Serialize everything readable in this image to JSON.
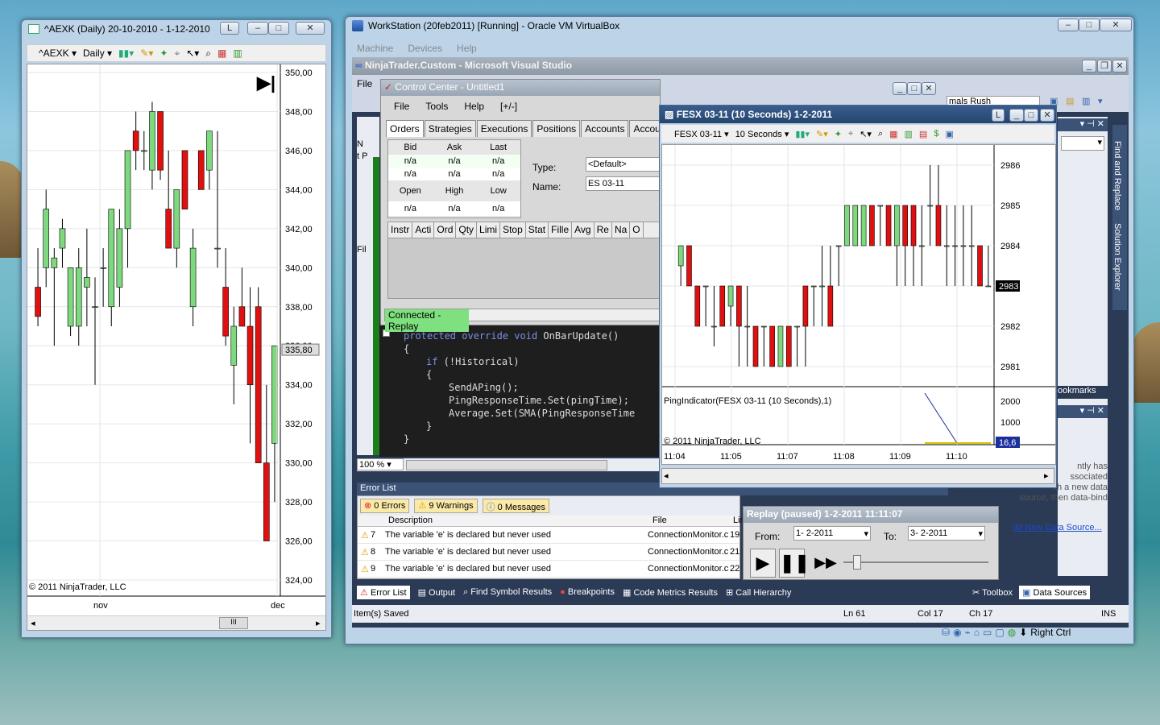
{
  "left_chart": {
    "title": "^AEXK (Daily)  20-10-2010 - 1-12-2010",
    "title_badge": "L",
    "instrument": "^AEXK",
    "period": "Daily",
    "price_label": "335,80",
    "copyright": "© 2011 NinjaTrader, LLC",
    "scroll_mark": "III",
    "y_ticks": [
      "350,00",
      "348,00",
      "346,00",
      "344,00",
      "342,00",
      "340,00",
      "338,00",
      "336,00",
      "334,00",
      "332,00",
      "330,00",
      "328,00",
      "326,00",
      "324,00"
    ],
    "x_ticks": [
      "nov",
      "dec"
    ]
  },
  "vbox": {
    "title": "WorkStation (20feb2011) [Running] - Oracle VM VirtualBox",
    "menu": [
      "Machine",
      "Devices",
      "Help"
    ],
    "status_right": "Right Ctrl"
  },
  "vs": {
    "title": "NinjaTrader.Custom - Microsoft Visual Studio",
    "file_menu": "File",
    "zoom": "100 %",
    "code_lines": [
      "protected override void OnBarUpdate()",
      "{",
      "if (!Historical)",
      "{",
      "SendAPing();",
      "PingResponseTime.Set(pingTime);",
      "Average.Set(SMA(PingResponseTime",
      "}",
      "}"
    ],
    "error_list": {
      "title": "Error List",
      "errors": "0 Errors",
      "warnings": "9 Warnings",
      "messages": "0 Messages",
      "col_description": "Description",
      "col_file": "File",
      "col_line": "Lin",
      "rows": [
        {
          "num": "7",
          "desc": "The variable 'e' is declared but never used",
          "file": "ConnectionMonitor.c",
          "line": "19"
        },
        {
          "num": "8",
          "desc": "The variable 'e' is declared but never used",
          "file": "ConnectionMonitor.c",
          "line": "21"
        },
        {
          "num": "9",
          "desc": "The variable 'e' is declared but never used",
          "file": "ConnectionMonitor.c",
          "line": "22"
        }
      ]
    },
    "bottom_tabs": [
      "Error List",
      "Output",
      "Find Symbol Results",
      "Breakpoints",
      "Code Metrics Results",
      "Call Hierarchy"
    ],
    "right_tabs": [
      "Toolbox",
      "Data Sources"
    ],
    "status": {
      "saved": "Item(s) Saved",
      "ln": "Ln 61",
      "col": "Col 17",
      "ch": "Ch 17",
      "ins": "INS"
    },
    "side_labels": [
      "Find and Replace",
      "Solution Explorer"
    ],
    "bookmarks": "ookmarks",
    "ds_text": [
      "ntly has",
      "ssociated",
      "ith a new data",
      "source, then data-bind"
    ],
    "ds_link": "dd New Data Source...",
    "partial_text": "mals Rush",
    "left_partials": [
      "N",
      "t P",
      "Fil"
    ]
  },
  "control_center": {
    "title": "Control Center - Untitled1",
    "menu": [
      "File",
      "Tools",
      "Help",
      "[+/-]"
    ],
    "tabs": [
      "Orders",
      "Strategies",
      "Executions",
      "Positions",
      "Accounts",
      "Account Pe"
    ],
    "quote_headers": [
      "Bid",
      "Ask",
      "Last"
    ],
    "quote_rows": [
      [
        "n/a",
        "n/a",
        "n/a"
      ],
      [
        "n/a",
        "n/a",
        "n/a"
      ]
    ],
    "ohl_headers": [
      "Open",
      "High",
      "Low"
    ],
    "ohl_values": [
      "n/a",
      "n/a",
      "n/a"
    ],
    "type_label": "Type:",
    "type_value": "<Default>",
    "name_label": "Name:",
    "name_value": "ES 03-11",
    "order_cols": [
      "Instr",
      "Acti",
      "Ord",
      "Qty",
      "Limi",
      "Stop",
      "Stat",
      "Fille",
      "Avg",
      "Re",
      "Na",
      "O"
    ],
    "status": "Connected - Replay"
  },
  "fesx": {
    "title": "FESX 03-11 (10 Seconds)  1-2-2011",
    "title_badge": "L",
    "instrument": "FESX 03-11",
    "period": "10 Seconds",
    "price_label": "2983",
    "indicator_label": "PingIndicator(FESX 03-11 (10 Seconds),1)",
    "indicator_value": "16,6",
    "copyright": "© 2011 NinjaTrader, LLC",
    "y_ticks": [
      "2986",
      "2985",
      "2984",
      "2983",
      "2982",
      "2981"
    ],
    "ind_ticks": [
      "2000",
      "1000"
    ],
    "x_ticks": [
      "11:04",
      "11:05",
      "11:07",
      "11:08",
      "11:09",
      "11:10"
    ]
  },
  "replay": {
    "title": "Replay (paused) 1-2-2011 11:11:07",
    "from_label": "From:",
    "from_value": "1- 2-2011",
    "to_label": "To:",
    "to_value": "3- 2-2011"
  },
  "chart_data": [
    {
      "type": "candlestick",
      "title": "^AEXK (Daily)",
      "ylim": [
        324,
        350
      ],
      "x_ticks": [
        "nov",
        "dec"
      ],
      "last": 335.8,
      "candles": [
        [
          339,
          341,
          337,
          337.5
        ],
        [
          340,
          344,
          339,
          343
        ],
        [
          340,
          341,
          336,
          340.5
        ],
        [
          341,
          342.5,
          340,
          342
        ],
        [
          337,
          340,
          336.5,
          340
        ],
        [
          337,
          341,
          336,
          340
        ],
        [
          339,
          342,
          337,
          339.5
        ],
        [
          338,
          339.5,
          334,
          338
        ],
        [
          340,
          341,
          338,
          340
        ],
        [
          338,
          343,
          337,
          343
        ],
        [
          339,
          343,
          338,
          342
        ],
        [
          342,
          346,
          340,
          346
        ],
        [
          347,
          348,
          345,
          346
        ],
        [
          346,
          347,
          345,
          346
        ],
        [
          345,
          348.5,
          344,
          348
        ],
        [
          348,
          348,
          344.5,
          345
        ],
        [
          343,
          346,
          341,
          341
        ],
        [
          341,
          344,
          340,
          344
        ],
        [
          346,
          346,
          343,
          343
        ],
        [
          338,
          342,
          337,
          341
        ],
        [
          346,
          346,
          344,
          344
        ],
        [
          345,
          347,
          344,
          347
        ],
        [
          341,
          347,
          340,
          341
        ],
        [
          339,
          341,
          336,
          336.5
        ],
        [
          335,
          338,
          333,
          337
        ],
        [
          338,
          340,
          337,
          337
        ],
        [
          337,
          339,
          331,
          334
        ],
        [
          338,
          339,
          332,
          330
        ],
        [
          330,
          334,
          326,
          326
        ],
        [
          331,
          336,
          328,
          336
        ]
      ]
    },
    {
      "type": "candlestick",
      "title": "FESX 03-11 (10 Seconds)",
      "ylim": [
        2980.5,
        2986.3
      ],
      "x_ticks": [
        "11:04",
        "11:05",
        "11:07",
        "11:08",
        "11:09",
        "11:10"
      ],
      "last": 2983,
      "candles": [
        [
          2983.5,
          2984,
          2983,
          2984
        ],
        [
          2984,
          2984,
          2983,
          2983
        ],
        [
          2983,
          2983,
          2982,
          2982
        ],
        [
          2983,
          2983,
          2982,
          2983
        ],
        [
          2982,
          2983,
          2981.5,
          2982
        ],
        [
          2983,
          2983,
          2982,
          2982
        ],
        [
          2982.5,
          2983,
          2982,
          2983
        ],
        [
          2983,
          2983,
          2981,
          2982
        ],
        [
          2982,
          2983,
          2981,
          2982
        ],
        [
          2982,
          2982,
          2981,
          2981
        ],
        [
          2982,
          2982,
          2981,
          2982
        ],
        [
          2982,
          2982,
          2981,
          2981
        ],
        [
          2981,
          2982,
          2981,
          2982
        ],
        [
          2982,
          2982,
          2981,
          2981
        ],
        [
          2982,
          2982,
          2981,
          2982
        ],
        [
          2983,
          2983,
          2981,
          2982
        ],
        [
          2983,
          2983,
          2982,
          2983
        ],
        [
          2983,
          2984,
          2982,
          2983
        ],
        [
          2983,
          2984,
          2982,
          2982
        ],
        [
          2984,
          2984,
          2983,
          2984
        ],
        [
          2984,
          2985,
          2984,
          2985
        ],
        [
          2984,
          2985,
          2984,
          2985
        ],
        [
          2984,
          2985,
          2984,
          2985
        ],
        [
          2985,
          2985,
          2984,
          2984
        ],
        [
          2985,
          2985,
          2984,
          2985
        ],
        [
          2985,
          2985,
          2984,
          2984
        ],
        [
          2984,
          2985,
          2983,
          2985
        ],
        [
          2985,
          2985,
          2983,
          2984
        ],
        [
          2985,
          2985,
          2983,
          2984
        ],
        [
          2984,
          2985,
          2983,
          2984
        ],
        [
          2985,
          2986,
          2984,
          2985
        ],
        [
          2985,
          2986,
          2984,
          2984
        ],
        [
          2984,
          2985,
          2983,
          2984
        ],
        [
          2984,
          2985,
          2983,
          2984
        ],
        [
          2984,
          2985,
          2983,
          2984
        ],
        [
          2984,
          2985,
          2983,
          2984
        ],
        [
          2984,
          2984,
          2983,
          2983
        ],
        [
          2983,
          2984,
          2983,
          2983
        ]
      ]
    }
  ]
}
